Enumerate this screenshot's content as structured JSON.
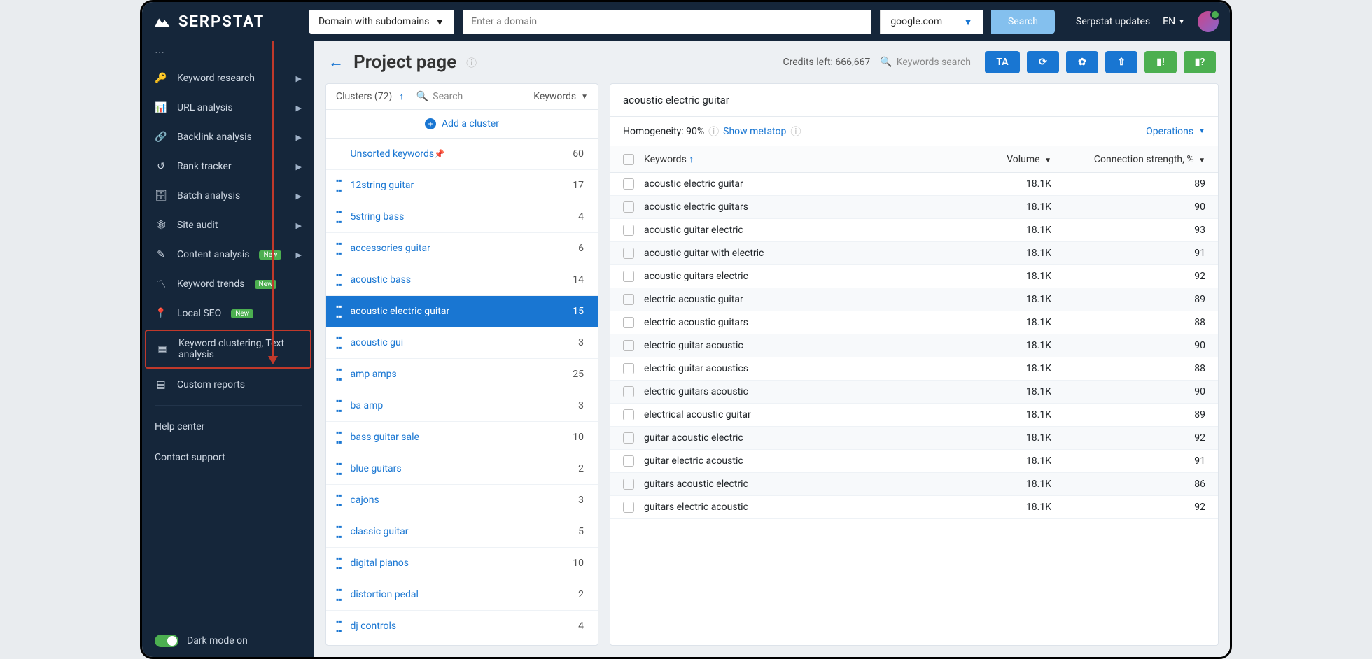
{
  "topbar": {
    "logo_text": "SERPSTAT",
    "search_type": "Domain with subdomains",
    "search_placeholder": "Enter a domain",
    "search_engine": "google.com",
    "search_button": "Search",
    "updates": "Serpstat updates",
    "language": "EN"
  },
  "sidebar": {
    "items": [
      {
        "icon": "key",
        "label": "Keyword research",
        "chevron": true
      },
      {
        "icon": "bars",
        "label": "URL analysis",
        "chevron": true
      },
      {
        "icon": "link",
        "label": "Backlink analysis",
        "chevron": true
      },
      {
        "icon": "history",
        "label": "Rank tracker",
        "chevron": true
      },
      {
        "icon": "db",
        "label": "Batch analysis",
        "chevron": true
      },
      {
        "icon": "site",
        "label": "Site audit",
        "chevron": true
      },
      {
        "icon": "pencil",
        "label": "Content analysis",
        "chevron": true,
        "new": true
      },
      {
        "icon": "trend",
        "label": "Keyword trends",
        "new": true
      },
      {
        "icon": "pin",
        "label": "Local SEO",
        "new": true
      },
      {
        "icon": "grid",
        "label": "Keyword clustering, Text analysis",
        "highlighted": true
      },
      {
        "icon": "report",
        "label": "Custom reports"
      }
    ],
    "help": "Help center",
    "contact": "Contact support",
    "darkmode": "Dark mode on"
  },
  "page": {
    "title": "Project page",
    "credits": "Credits left: 666,667",
    "keywords_search_placeholder": "Keywords search",
    "ta_button": "TA"
  },
  "clusters": {
    "header_label": "Clusters (72)",
    "search_placeholder": "Search",
    "keywords_col": "Keywords",
    "add_label": "Add a cluster",
    "rows": [
      {
        "name": "Unsorted keywords",
        "count": 60,
        "unsorted": true
      },
      {
        "name": "12string guitar",
        "count": 17
      },
      {
        "name": "5string bass",
        "count": 4
      },
      {
        "name": "accessories guitar",
        "count": 6
      },
      {
        "name": "acoustic bass",
        "count": 14
      },
      {
        "name": "acoustic electric guitar",
        "count": 15,
        "active": true
      },
      {
        "name": "acoustic gui",
        "count": 3
      },
      {
        "name": "amp amps",
        "count": 25
      },
      {
        "name": "ba amp",
        "count": 3
      },
      {
        "name": "bass guitar sale",
        "count": 10
      },
      {
        "name": "blue guitars",
        "count": 2
      },
      {
        "name": "cajons",
        "count": 3
      },
      {
        "name": "classic guitar",
        "count": 5
      },
      {
        "name": "digital pianos",
        "count": 10
      },
      {
        "name": "distortion pedal",
        "count": 2
      },
      {
        "name": "dj controls",
        "count": 4
      }
    ]
  },
  "keywords": {
    "title": "acoustic electric guitar",
    "homogeneity_label": "Homogeneity: 90%",
    "show_metatop": "Show metatop",
    "operations": "Operations",
    "columns": {
      "keywords": "Keywords",
      "volume": "Volume",
      "connection": "Connection strength, %"
    },
    "rows": [
      {
        "kw": "acoustic electric guitar",
        "vol": "18.1K",
        "conn": 89
      },
      {
        "kw": "acoustic electric guitars",
        "vol": "18.1K",
        "conn": 90
      },
      {
        "kw": "acoustic guitar electric",
        "vol": "18.1K",
        "conn": 93
      },
      {
        "kw": "acoustic guitar with electric",
        "vol": "18.1K",
        "conn": 91
      },
      {
        "kw": "acoustic guitars electric",
        "vol": "18.1K",
        "conn": 92
      },
      {
        "kw": "electric acoustic guitar",
        "vol": "18.1K",
        "conn": 89
      },
      {
        "kw": "electric acoustic guitars",
        "vol": "18.1K",
        "conn": 88
      },
      {
        "kw": "electric guitar acoustic",
        "vol": "18.1K",
        "conn": 90
      },
      {
        "kw": "electric guitar acoustics",
        "vol": "18.1K",
        "conn": 88
      },
      {
        "kw": "electric guitars acoustic",
        "vol": "18.1K",
        "conn": 90
      },
      {
        "kw": "electrical acoustic guitar",
        "vol": "18.1K",
        "conn": 89
      },
      {
        "kw": "guitar acoustic electric",
        "vol": "18.1K",
        "conn": 92
      },
      {
        "kw": "guitar electric acoustic",
        "vol": "18.1K",
        "conn": 91
      },
      {
        "kw": "guitars acoustic electric",
        "vol": "18.1K",
        "conn": 86
      },
      {
        "kw": "guitars electric acoustic",
        "vol": "18.1K",
        "conn": 92
      }
    ]
  }
}
